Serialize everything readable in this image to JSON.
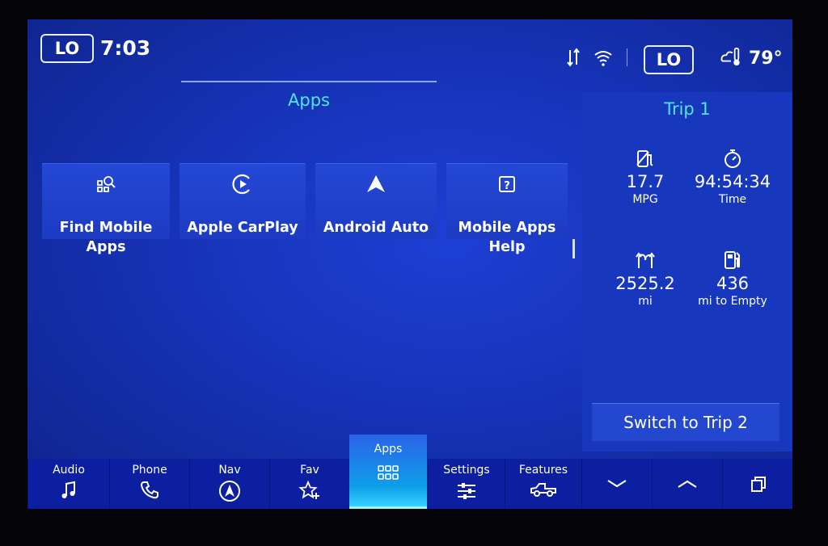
{
  "status": {
    "left_badge": "LO",
    "time": "7:03",
    "right_badge": "LO",
    "temperature": "79°",
    "icons": [
      "data-transfer-icon",
      "wifi-icon",
      "weather-temperature-icon"
    ]
  },
  "apps": {
    "title": "Apps",
    "tiles": [
      {
        "label": "Find Mobile Apps",
        "icon": "find-apps-icon"
      },
      {
        "label": "Apple CarPlay",
        "icon": "carplay-icon"
      },
      {
        "label": "Android Auto",
        "icon": "android-auto-icon"
      },
      {
        "label": "Mobile Apps Help",
        "icon": "help-icon"
      }
    ]
  },
  "trip": {
    "title": "Trip 1",
    "stats": [
      {
        "value": "17.7",
        "unit": "MPG",
        "icon": "fuel-economy-icon"
      },
      {
        "value": "94:54:34",
        "unit": "Time",
        "icon": "stopwatch-icon"
      },
      {
        "value": "2525.2",
        "unit": "mi",
        "icon": "distance-icon"
      },
      {
        "value": "436",
        "unit": "mi to Empty",
        "icon": "fuel-pump-icon"
      }
    ],
    "switch_label": "Switch to Trip 2"
  },
  "nav": {
    "items": [
      {
        "label": "Audio",
        "icon": "music-note-icon"
      },
      {
        "label": "Phone",
        "icon": "phone-icon"
      },
      {
        "label": "Nav",
        "icon": "navigation-icon"
      },
      {
        "label": "Fav",
        "icon": "star-plus-icon"
      },
      {
        "label": "Apps",
        "icon": "apps-grid-icon"
      },
      {
        "label": "Settings",
        "icon": "sliders-icon"
      },
      {
        "label": "Features",
        "icon": "truck-icon"
      }
    ],
    "controls": [
      "chevron-down-icon",
      "chevron-up-icon",
      "window-stack-icon"
    ]
  },
  "colors": {
    "accent_cyan": "#4ee6f0",
    "background_blue": "#1633b8",
    "nav_blue": "#0b1fa0",
    "active_tab": "#0e9ee8"
  }
}
